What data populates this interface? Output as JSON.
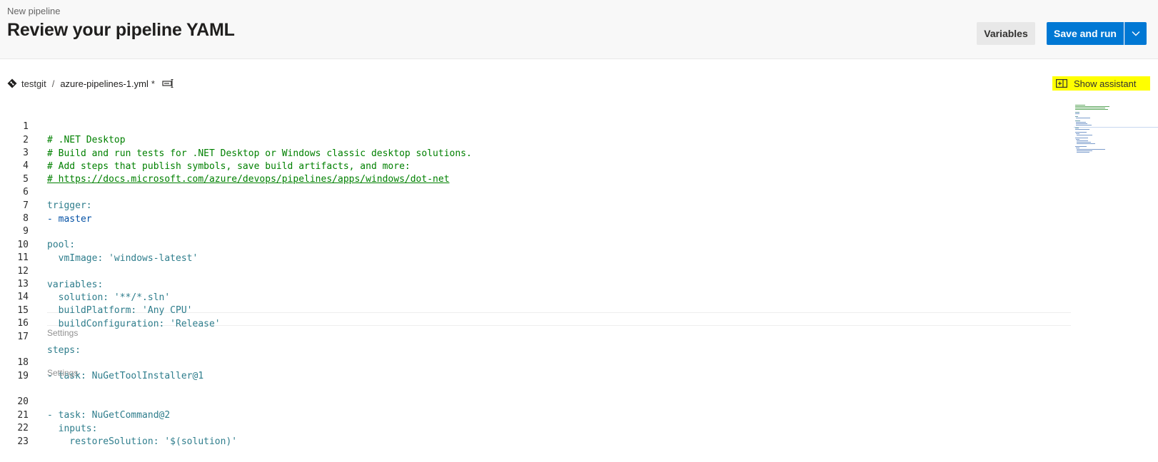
{
  "header": {
    "subtitle": "New pipeline",
    "title": "Review your pipeline YAML",
    "variables_label": "Variables",
    "save_run_label": "Save and run"
  },
  "file_bar": {
    "repo": "testgit",
    "separator": "/",
    "file_name": "azure-pipelines-1.yml",
    "dirty_marker": "*"
  },
  "assistant": {
    "label": "Show assistant"
  },
  "codelens": {
    "settings_1": "Settings",
    "settings_2": "Settings"
  },
  "editor": {
    "lines": [
      {
        "n": "1",
        "text": "# .NET Desktop"
      },
      {
        "n": "2",
        "text": "# Build and run tests for .NET Desktop or Windows classic desktop solutions."
      },
      {
        "n": "3",
        "text": "# Add steps that publish symbols, save build artifacts, and more:"
      },
      {
        "n": "4",
        "text": "# https://docs.microsoft.com/azure/devops/pipelines/apps/windows/dot-net"
      },
      {
        "n": "5",
        "text": ""
      },
      {
        "n": "6",
        "text": "trigger:"
      },
      {
        "n": "7",
        "text": "- master"
      },
      {
        "n": "8",
        "text": ""
      },
      {
        "n": "9",
        "text": "pool:"
      },
      {
        "n": "10",
        "text": "  vmImage: 'windows-latest'"
      },
      {
        "n": "11",
        "text": ""
      },
      {
        "n": "12",
        "text": "variables:"
      },
      {
        "n": "13",
        "text": "  solution: '**/*.sln'"
      },
      {
        "n": "14",
        "text": "  buildPlatform: 'Any CPU'"
      },
      {
        "n": "15",
        "text": "  buildConfiguration: 'Release'"
      },
      {
        "n": "16",
        "text": ""
      },
      {
        "n": "17",
        "text": "steps:"
      },
      {
        "n": "18",
        "text": "- task: NuGetToolInstaller@1"
      },
      {
        "n": "19",
        "text": ""
      },
      {
        "n": "20",
        "text": "- task: NuGetCommand@2"
      },
      {
        "n": "21",
        "text": "  inputs:"
      },
      {
        "n": "22",
        "text": "    restoreSolution: '$(solution)'"
      },
      {
        "n": "23",
        "text": ""
      }
    ]
  },
  "colors": {
    "primary": "#0078d4",
    "highlight": "#ffff00",
    "comment": "#008000",
    "key": "#2e7d8c",
    "string": "#0451a5"
  }
}
